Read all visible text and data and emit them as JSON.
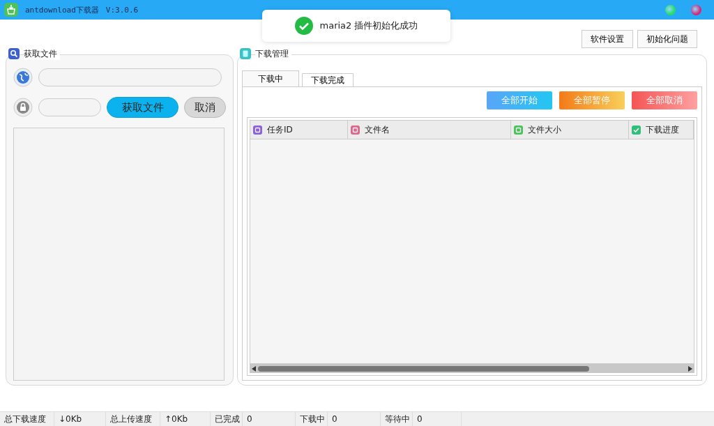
{
  "window": {
    "title": "antdownload下载器",
    "version": "V:3.0.6"
  },
  "toast": {
    "message": "maria2 插件初始化成功"
  },
  "top_buttons": [
    "软件设置",
    "初始化问题"
  ],
  "fetch_panel": {
    "title": "获取文件",
    "fetch_button": "获取文件",
    "cancel_button": "取消"
  },
  "download_panel": {
    "title": "下载管理",
    "tabs": [
      {
        "label": "下载中",
        "selected": true
      },
      {
        "label": "下载完成",
        "selected": false
      }
    ],
    "actions": [
      {
        "label": "全部开始",
        "kind": "start"
      },
      {
        "label": "全部暂停",
        "kind": "pause"
      },
      {
        "label": "全部取消",
        "kind": "cancel"
      }
    ],
    "columns": [
      {
        "label": "任务ID",
        "kind": "edit"
      },
      {
        "label": "文件名",
        "kind": "file"
      },
      {
        "label": "文件大小",
        "kind": "size"
      },
      {
        "label": "下载进度",
        "kind": "check"
      }
    ]
  },
  "status_bar": [
    {
      "label": "总下载速度",
      "value": "↓0Kb"
    },
    {
      "label": "总上传速度",
      "value": "↑0Kb"
    },
    {
      "label": "已完成",
      "value": "0"
    },
    {
      "label": "下载中",
      "value": "0"
    },
    {
      "label": "等待中",
      "value": "0"
    }
  ]
}
